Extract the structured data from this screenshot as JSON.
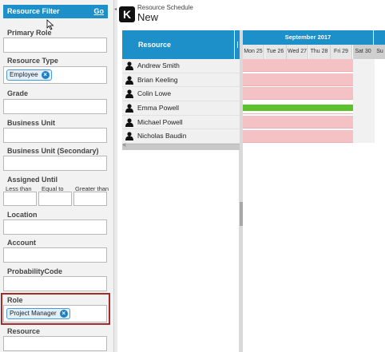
{
  "filter": {
    "title": "Resource Filter",
    "go_label": "Go",
    "primary_role_label": "Primary Role",
    "resource_type_label": "Resource Type",
    "resource_type_value": "Employee",
    "grade_label": "Grade",
    "business_unit_label": "Business Unit",
    "business_unit_secondary_label": "Business Unit (Secondary)",
    "assigned_until_label": "Assigned Until",
    "less_than_label": "Less than",
    "equal_to_label": "Equal to",
    "greater_than_label": "Greater than",
    "location_label": "Location",
    "account_label": "Account",
    "probability_code_label": "ProbabilityCode",
    "role_label": "Role",
    "role_value": "Project Manager",
    "resource_label": "Resource",
    "chip_remove_glyph": "×"
  },
  "header": {
    "logo_letter": "K",
    "module": "Resource Schedule",
    "title": "New"
  },
  "grid": {
    "resource_column": "Resource",
    "resources": [
      "Andrew Smith",
      "Brian Keeling",
      "Colin Lowe",
      "Emma Powell",
      "Michael Powell",
      "Nicholas Baudin"
    ],
    "scroll_left_glyph": "<"
  },
  "timeline": {
    "month": "September 2017",
    "days": [
      "Mon 25",
      "Tue 26",
      "Wed 27",
      "Thu 28",
      "Fri 29",
      "Sat 30",
      "Su"
    ],
    "weekend_index": [
      5,
      6
    ],
    "allocated_color": "#f4c2c4",
    "booked_color": "#5cc12b",
    "booked_resource": "Emma Powell"
  },
  "colors": {
    "accent": "#1d8fc9",
    "highlight_border": "#a52a2a"
  }
}
